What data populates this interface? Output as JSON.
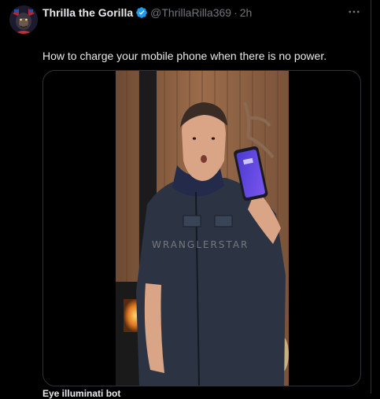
{
  "tweet": {
    "author": {
      "display_name": "Thrilla the Gorilla",
      "handle": "@ThrillaRilla369",
      "verified": true
    },
    "time": "2h",
    "separator": "·",
    "more_icon": "more-horizontal-icon",
    "text": "How to charge your mobile phone when there is no power.",
    "media": {
      "type": "video",
      "watermark": "WRANGLERSTAR"
    }
  },
  "next_tweet": {
    "author_partial": "Eye illuminati bot"
  },
  "colors": {
    "background": "#000000",
    "text": "#e7e9ea",
    "muted": "#71767b",
    "border": "#2f3336",
    "verified": "#1d9bf0"
  }
}
